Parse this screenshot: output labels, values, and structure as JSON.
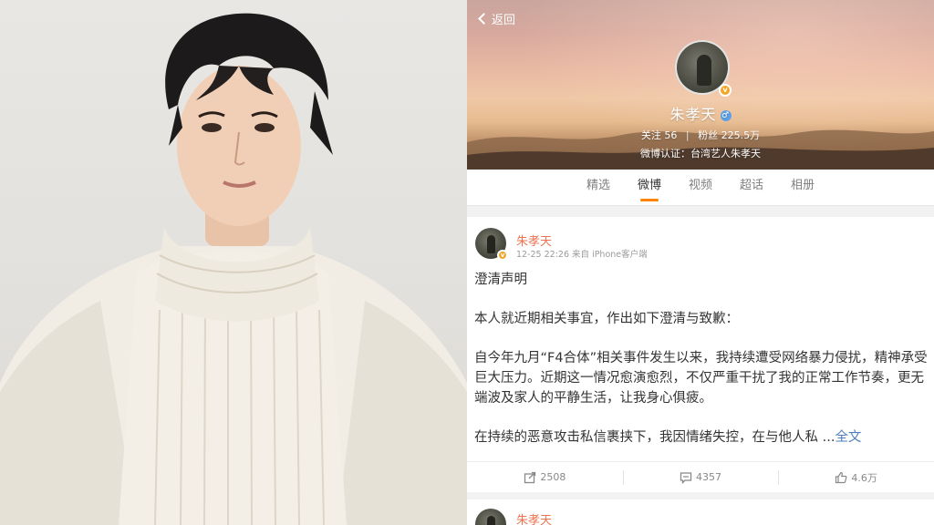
{
  "profile": {
    "back_label": "返回",
    "name": "朱孝天",
    "gender_symbol": "♂",
    "verified_symbol": "v",
    "following_label": "关注",
    "following_count": "56",
    "followers_label": "粉丝",
    "followers_count": "225.5万",
    "cert_text": "微博认证：台湾艺人朱孝天"
  },
  "tabs": [
    {
      "label": "精选",
      "active": false
    },
    {
      "label": "微博",
      "active": true
    },
    {
      "label": "视频",
      "active": false
    },
    {
      "label": "超话",
      "active": false
    },
    {
      "label": "相册",
      "active": false
    }
  ],
  "post": {
    "author": "朱孝天",
    "time": "12-25 22:26",
    "source": "来自 iPhone客户端",
    "paragraphs": [
      "澄清声明",
      "本人就近期相关事宜，作出如下澄清与致歉：",
      "自今年九月“F4合体”相关事件发生以来，我持续遭受网络暴力侵扰，精神承受巨大压力。近期这一情况愈演愈烈，不仅严重干扰了我的正常工作节奏，更无端波及家人的平静生活，让我身心俱疲。"
    ],
    "last_paragraph": "在持续的恶意攻击私信裹挟下，我因情绪失控，在与他人私 ...",
    "more_label": "全文",
    "reposts": "2508",
    "comments": "4357",
    "likes": "4.6万"
  },
  "next_post": {
    "author": "朱孝天"
  },
  "colors": {
    "accent": "#ff8200",
    "author_name": "#eb7350",
    "link": "#4d7fbf"
  }
}
